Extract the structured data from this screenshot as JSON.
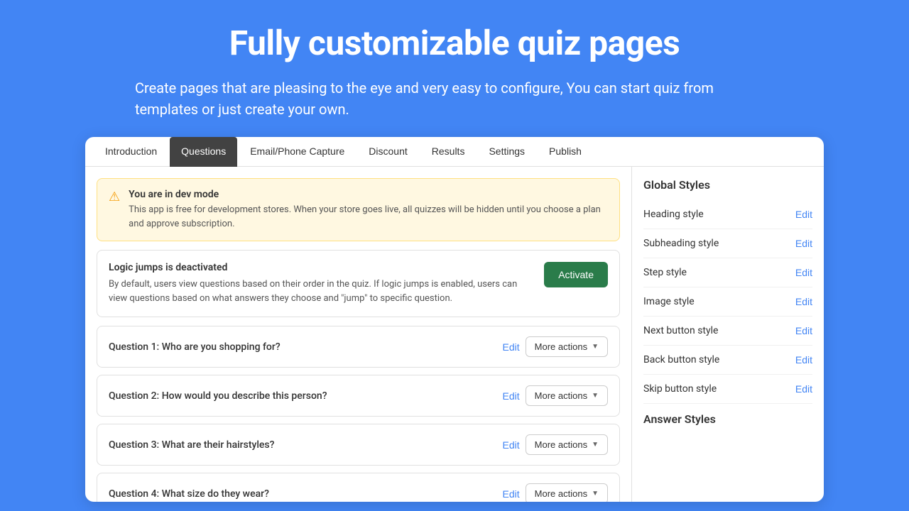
{
  "hero": {
    "title": "Fully customizable quiz pages",
    "subtitle": "Create pages that are pleasing to the eye and very easy to configure, You can start quiz from templates or just create your own."
  },
  "tabs": [
    {
      "id": "introduction",
      "label": "Introduction",
      "active": false
    },
    {
      "id": "questions",
      "label": "Questions",
      "active": true
    },
    {
      "id": "email-phone-capture",
      "label": "Email/Phone Capture",
      "active": false
    },
    {
      "id": "discount",
      "label": "Discount",
      "active": false
    },
    {
      "id": "results",
      "label": "Results",
      "active": false
    },
    {
      "id": "settings",
      "label": "Settings",
      "active": false
    },
    {
      "id": "publish",
      "label": "Publish",
      "active": false
    }
  ],
  "dev_mode_banner": {
    "title": "You are in dev mode",
    "text": "This app is free for development stores. When your store goes live, all quizzes will be hidden until you choose a plan and approve subscription."
  },
  "logic_jumps": {
    "title": "Logic jumps is deactivated",
    "text": "By default, users view questions based on their order in the quiz. If logic jumps is enabled, users can view questions based on what answers they choose and \"jump\" to specific question.",
    "activate_label": "Activate"
  },
  "questions": [
    {
      "label": "Question 1: Who are you shopping for?",
      "edit_label": "Edit",
      "more_label": "More actions"
    },
    {
      "label": "Question 2: How would you describe this person?",
      "edit_label": "Edit",
      "more_label": "More actions"
    },
    {
      "label": "Question 3: What are their hairstyles?",
      "edit_label": "Edit",
      "more_label": "More actions"
    },
    {
      "label": "Question 4: What size do they wear?",
      "edit_label": "Edit",
      "more_label": "More actions"
    }
  ],
  "right_panel": {
    "global_styles_title": "Global Styles",
    "styles": [
      {
        "label": "Heading style",
        "edit_label": "Edit"
      },
      {
        "label": "Subheading style",
        "edit_label": "Edit"
      },
      {
        "label": "Step style",
        "edit_label": "Edit"
      },
      {
        "label": "Image style",
        "edit_label": "Edit"
      },
      {
        "label": "Next button style",
        "edit_label": "Edit"
      },
      {
        "label": "Back button style",
        "edit_label": "Edit"
      },
      {
        "label": "Skip button style",
        "edit_label": "Edit"
      }
    ],
    "answer_styles_title": "Answer Styles"
  }
}
